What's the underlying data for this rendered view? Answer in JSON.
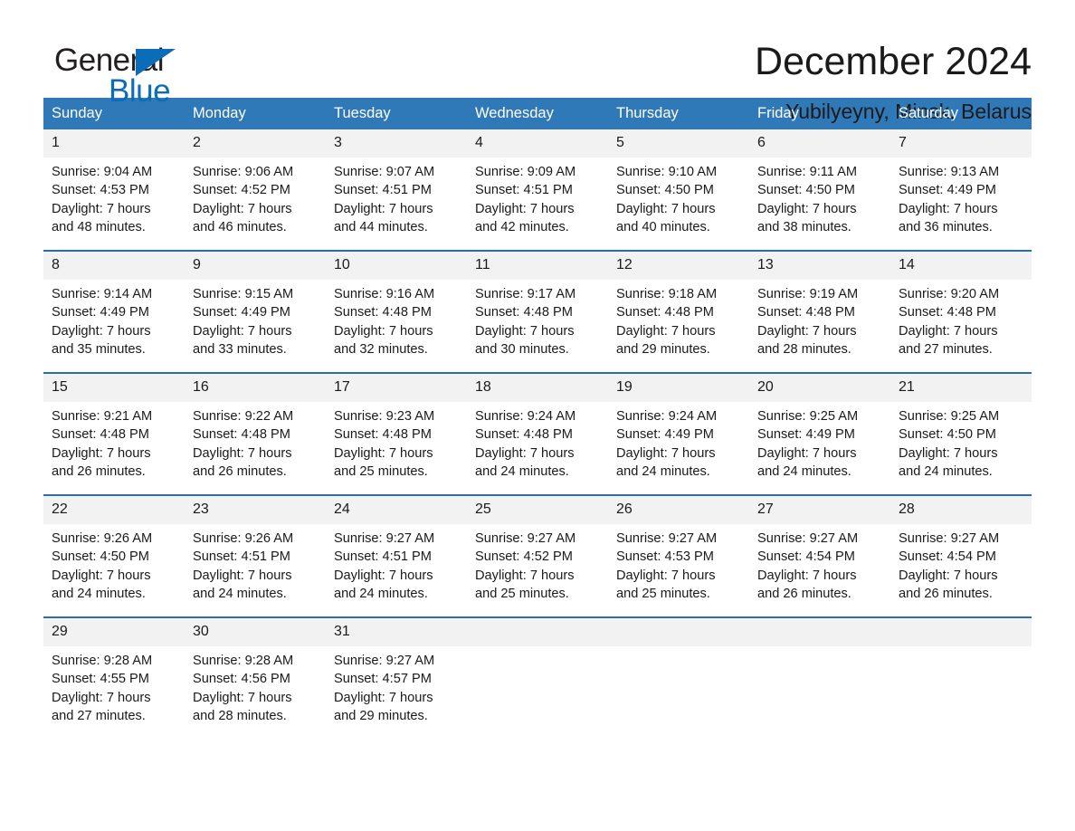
{
  "logo": {
    "word_one": "General",
    "word_two": "Blue",
    "triangle_color": "#0b6cb7"
  },
  "header": {
    "title": "December 2024",
    "location": "Yubilyeyny, Minsk, Belarus"
  },
  "colors": {
    "header_blue": "#3079b8",
    "row_divider": "#2e6da4",
    "daynum_band": "#f2f2f2",
    "text": "#1a1a1a"
  },
  "calendar": {
    "weekday_headers": [
      "Sunday",
      "Monday",
      "Tuesday",
      "Wednesday",
      "Thursday",
      "Friday",
      "Saturday"
    ],
    "weeks": [
      [
        {
          "day": "1",
          "sunrise": "Sunrise: 9:04 AM",
          "sunset": "Sunset: 4:53 PM",
          "daylight_1": "Daylight: 7 hours",
          "daylight_2": "and 48 minutes."
        },
        {
          "day": "2",
          "sunrise": "Sunrise: 9:06 AM",
          "sunset": "Sunset: 4:52 PM",
          "daylight_1": "Daylight: 7 hours",
          "daylight_2": "and 46 minutes."
        },
        {
          "day": "3",
          "sunrise": "Sunrise: 9:07 AM",
          "sunset": "Sunset: 4:51 PM",
          "daylight_1": "Daylight: 7 hours",
          "daylight_2": "and 44 minutes."
        },
        {
          "day": "4",
          "sunrise": "Sunrise: 9:09 AM",
          "sunset": "Sunset: 4:51 PM",
          "daylight_1": "Daylight: 7 hours",
          "daylight_2": "and 42 minutes."
        },
        {
          "day": "5",
          "sunrise": "Sunrise: 9:10 AM",
          "sunset": "Sunset: 4:50 PM",
          "daylight_1": "Daylight: 7 hours",
          "daylight_2": "and 40 minutes."
        },
        {
          "day": "6",
          "sunrise": "Sunrise: 9:11 AM",
          "sunset": "Sunset: 4:50 PM",
          "daylight_1": "Daylight: 7 hours",
          "daylight_2": "and 38 minutes."
        },
        {
          "day": "7",
          "sunrise": "Sunrise: 9:13 AM",
          "sunset": "Sunset: 4:49 PM",
          "daylight_1": "Daylight: 7 hours",
          "daylight_2": "and 36 minutes."
        }
      ],
      [
        {
          "day": "8",
          "sunrise": "Sunrise: 9:14 AM",
          "sunset": "Sunset: 4:49 PM",
          "daylight_1": "Daylight: 7 hours",
          "daylight_2": "and 35 minutes."
        },
        {
          "day": "9",
          "sunrise": "Sunrise: 9:15 AM",
          "sunset": "Sunset: 4:49 PM",
          "daylight_1": "Daylight: 7 hours",
          "daylight_2": "and 33 minutes."
        },
        {
          "day": "10",
          "sunrise": "Sunrise: 9:16 AM",
          "sunset": "Sunset: 4:48 PM",
          "daylight_1": "Daylight: 7 hours",
          "daylight_2": "and 32 minutes."
        },
        {
          "day": "11",
          "sunrise": "Sunrise: 9:17 AM",
          "sunset": "Sunset: 4:48 PM",
          "daylight_1": "Daylight: 7 hours",
          "daylight_2": "and 30 minutes."
        },
        {
          "day": "12",
          "sunrise": "Sunrise: 9:18 AM",
          "sunset": "Sunset: 4:48 PM",
          "daylight_1": "Daylight: 7 hours",
          "daylight_2": "and 29 minutes."
        },
        {
          "day": "13",
          "sunrise": "Sunrise: 9:19 AM",
          "sunset": "Sunset: 4:48 PM",
          "daylight_1": "Daylight: 7 hours",
          "daylight_2": "and 28 minutes."
        },
        {
          "day": "14",
          "sunrise": "Sunrise: 9:20 AM",
          "sunset": "Sunset: 4:48 PM",
          "daylight_1": "Daylight: 7 hours",
          "daylight_2": "and 27 minutes."
        }
      ],
      [
        {
          "day": "15",
          "sunrise": "Sunrise: 9:21 AM",
          "sunset": "Sunset: 4:48 PM",
          "daylight_1": "Daylight: 7 hours",
          "daylight_2": "and 26 minutes."
        },
        {
          "day": "16",
          "sunrise": "Sunrise: 9:22 AM",
          "sunset": "Sunset: 4:48 PM",
          "daylight_1": "Daylight: 7 hours",
          "daylight_2": "and 26 minutes."
        },
        {
          "day": "17",
          "sunrise": "Sunrise: 9:23 AM",
          "sunset": "Sunset: 4:48 PM",
          "daylight_1": "Daylight: 7 hours",
          "daylight_2": "and 25 minutes."
        },
        {
          "day": "18",
          "sunrise": "Sunrise: 9:24 AM",
          "sunset": "Sunset: 4:48 PM",
          "daylight_1": "Daylight: 7 hours",
          "daylight_2": "and 24 minutes."
        },
        {
          "day": "19",
          "sunrise": "Sunrise: 9:24 AM",
          "sunset": "Sunset: 4:49 PM",
          "daylight_1": "Daylight: 7 hours",
          "daylight_2": "and 24 minutes."
        },
        {
          "day": "20",
          "sunrise": "Sunrise: 9:25 AM",
          "sunset": "Sunset: 4:49 PM",
          "daylight_1": "Daylight: 7 hours",
          "daylight_2": "and 24 minutes."
        },
        {
          "day": "21",
          "sunrise": "Sunrise: 9:25 AM",
          "sunset": "Sunset: 4:50 PM",
          "daylight_1": "Daylight: 7 hours",
          "daylight_2": "and 24 minutes."
        }
      ],
      [
        {
          "day": "22",
          "sunrise": "Sunrise: 9:26 AM",
          "sunset": "Sunset: 4:50 PM",
          "daylight_1": "Daylight: 7 hours",
          "daylight_2": "and 24 minutes."
        },
        {
          "day": "23",
          "sunrise": "Sunrise: 9:26 AM",
          "sunset": "Sunset: 4:51 PM",
          "daylight_1": "Daylight: 7 hours",
          "daylight_2": "and 24 minutes."
        },
        {
          "day": "24",
          "sunrise": "Sunrise: 9:27 AM",
          "sunset": "Sunset: 4:51 PM",
          "daylight_1": "Daylight: 7 hours",
          "daylight_2": "and 24 minutes."
        },
        {
          "day": "25",
          "sunrise": "Sunrise: 9:27 AM",
          "sunset": "Sunset: 4:52 PM",
          "daylight_1": "Daylight: 7 hours",
          "daylight_2": "and 25 minutes."
        },
        {
          "day": "26",
          "sunrise": "Sunrise: 9:27 AM",
          "sunset": "Sunset: 4:53 PM",
          "daylight_1": "Daylight: 7 hours",
          "daylight_2": "and 25 minutes."
        },
        {
          "day": "27",
          "sunrise": "Sunrise: 9:27 AM",
          "sunset": "Sunset: 4:54 PM",
          "daylight_1": "Daylight: 7 hours",
          "daylight_2": "and 26 minutes."
        },
        {
          "day": "28",
          "sunrise": "Sunrise: 9:27 AM",
          "sunset": "Sunset: 4:54 PM",
          "daylight_1": "Daylight: 7 hours",
          "daylight_2": "and 26 minutes."
        }
      ],
      [
        {
          "day": "29",
          "sunrise": "Sunrise: 9:28 AM",
          "sunset": "Sunset: 4:55 PM",
          "daylight_1": "Daylight: 7 hours",
          "daylight_2": "and 27 minutes."
        },
        {
          "day": "30",
          "sunrise": "Sunrise: 9:28 AM",
          "sunset": "Sunset: 4:56 PM",
          "daylight_1": "Daylight: 7 hours",
          "daylight_2": "and 28 minutes."
        },
        {
          "day": "31",
          "sunrise": "Sunrise: 9:27 AM",
          "sunset": "Sunset: 4:57 PM",
          "daylight_1": "Daylight: 7 hours",
          "daylight_2": "and 29 minutes."
        },
        {
          "day": "",
          "sunrise": "",
          "sunset": "",
          "daylight_1": "",
          "daylight_2": ""
        },
        {
          "day": "",
          "sunrise": "",
          "sunset": "",
          "daylight_1": "",
          "daylight_2": ""
        },
        {
          "day": "",
          "sunrise": "",
          "sunset": "",
          "daylight_1": "",
          "daylight_2": ""
        },
        {
          "day": "",
          "sunrise": "",
          "sunset": "",
          "daylight_1": "",
          "daylight_2": ""
        }
      ]
    ]
  }
}
